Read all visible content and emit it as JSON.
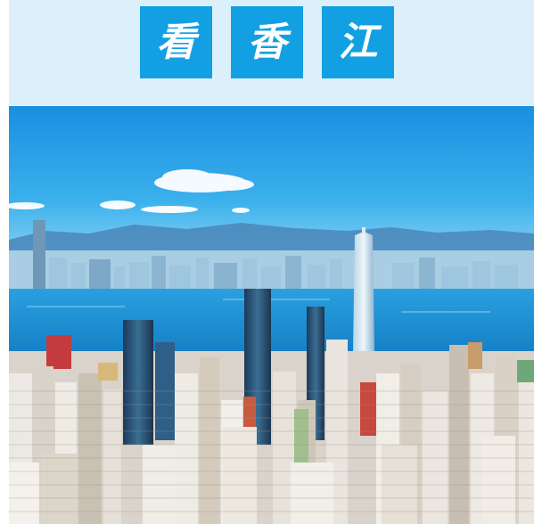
{
  "header": {
    "title_chars": [
      "看",
      "香",
      "江"
    ],
    "tile_color": "#12a0e3",
    "band_color": "#dcf0fb"
  },
  "photo": {
    "subject": "city-skyline-harbour",
    "sky_color": "#1f9fe3",
    "water_color": "#1c8fd6"
  }
}
